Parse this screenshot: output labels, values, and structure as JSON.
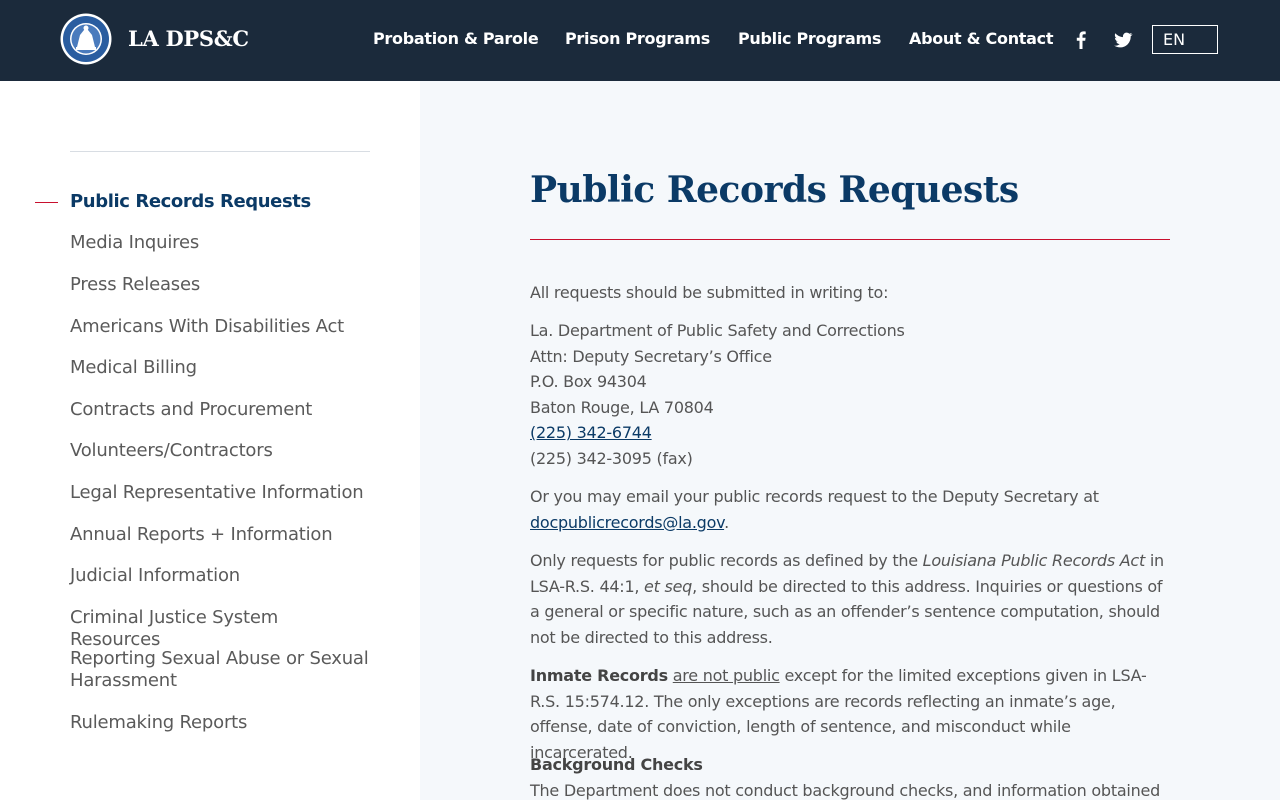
{
  "header": {
    "site_name": "LA DPS&C",
    "nav": [
      {
        "label": "Probation & Parole"
      },
      {
        "label": "Prison Programs"
      },
      {
        "label": "Public Programs"
      },
      {
        "label": "About & Contact"
      }
    ],
    "social": [
      "facebook-icon",
      "twitter-icon"
    ],
    "language": "EN",
    "colors": {
      "background": "#1b2a3b",
      "text": "#ffffff"
    }
  },
  "sidebar": {
    "items": [
      {
        "label": "Public Records Requests",
        "active": true
      },
      {
        "label": "Media Inquires"
      },
      {
        "label": "Press Releases"
      },
      {
        "label": "Americans With Disabilities Act"
      },
      {
        "label": "Medical Billing"
      },
      {
        "label": "Contracts and Procurement"
      },
      {
        "label": "Volunteers/Contractors"
      },
      {
        "label": "Legal Representative Information"
      },
      {
        "label": "Annual Reports + Information"
      },
      {
        "label": "Judicial Information"
      },
      {
        "label": "Criminal Justice System Resources"
      },
      {
        "label": "Reporting Sexual Abuse or Sexual Harassment"
      },
      {
        "label": "Rulemaking Reports"
      }
    ],
    "colors": {
      "active": "#0b3a66",
      "marker": "#c8102e"
    }
  },
  "main": {
    "title": "Public Records Requests",
    "intro": "All requests should be submitted in writing to:",
    "address": {
      "line1": "La. Department of Public Safety and Corrections",
      "line2": "Attn: Deputy Secretary’s Office",
      "line3": "P.O. Box 94304",
      "line4": "Baton Rouge, LA 70804",
      "phone": "(225) 342-6744",
      "fax": "(225) 342-3095 (fax)"
    },
    "email_para": {
      "text": "Or you may email your public records request to the Deputy Secretary at",
      "email": "docpublicrecords@la.gov",
      "end": "."
    },
    "only_para": {
      "p1": "Only requests for public records as defined by the ",
      "act": "Louisiana Public Records Act",
      "p2": " in LSA-R.S. 44:1, ",
      "etseq": "et seq",
      "p3": ", should be directed to this address.  Inquiries or questions of a general or specific nature, such as an offender’s sentence computation, should not be directed to this address."
    },
    "inmate_para": {
      "bold": "Inmate Records",
      "underline": "are not public",
      "rest": " except for the limited exceptions given in LSA-R.S. 15:574.12. The only exceptions are records reflecting an inmate’s age, offense, date of conviction, length of sentence, and misconduct while incarcerated."
    },
    "background": {
      "heading": "Background Checks",
      "text": "The Department does not conduct background checks, and information obtained"
    },
    "colors": {
      "title": "#0b3a66",
      "rule": "#c8102e",
      "link": "#0b3a66"
    }
  }
}
